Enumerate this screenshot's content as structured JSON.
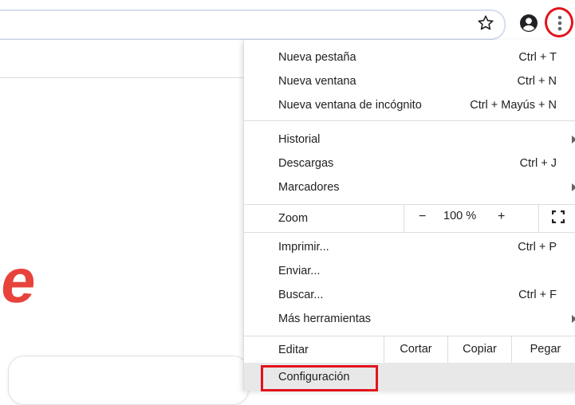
{
  "colors": {
    "highlight": "#e3131b",
    "logo": "#e7433a",
    "menu_text": "#202124",
    "separator": "#dadce0",
    "selected_row": "#e8e8e8"
  },
  "page": {
    "logo_fragment": "e"
  },
  "toolbar": {
    "star_icon": "star-outline-icon",
    "profile_icon": "account-circle-icon",
    "menu_icon": "more-vert-icon"
  },
  "menu": {
    "group1": [
      {
        "label": "Nueva pestaña",
        "shortcut": "Ctrl + T"
      },
      {
        "label": "Nueva ventana",
        "shortcut": "Ctrl + N"
      },
      {
        "label": "Nueva ventana de incógnito",
        "shortcut": "Ctrl + Mayús + N"
      }
    ],
    "group2": [
      {
        "label": "Historial",
        "shortcut": ""
      },
      {
        "label": "Descargas",
        "shortcut": "Ctrl + J"
      },
      {
        "label": "Marcadores",
        "shortcut": ""
      }
    ],
    "zoom": {
      "label": "Zoom",
      "minus": "−",
      "value": "100 %",
      "plus": "+"
    },
    "group3": [
      {
        "label": "Imprimir...",
        "shortcut": "Ctrl + P"
      },
      {
        "label": "Enviar...",
        "shortcut": ""
      },
      {
        "label": "Buscar...",
        "shortcut": "Ctrl + F"
      },
      {
        "label": "Más herramientas",
        "shortcut": ""
      }
    ],
    "edit": {
      "label": "Editar",
      "cut": "Cortar",
      "copy": "Copiar",
      "paste": "Pegar"
    },
    "settings": {
      "label": "Configuración"
    }
  }
}
